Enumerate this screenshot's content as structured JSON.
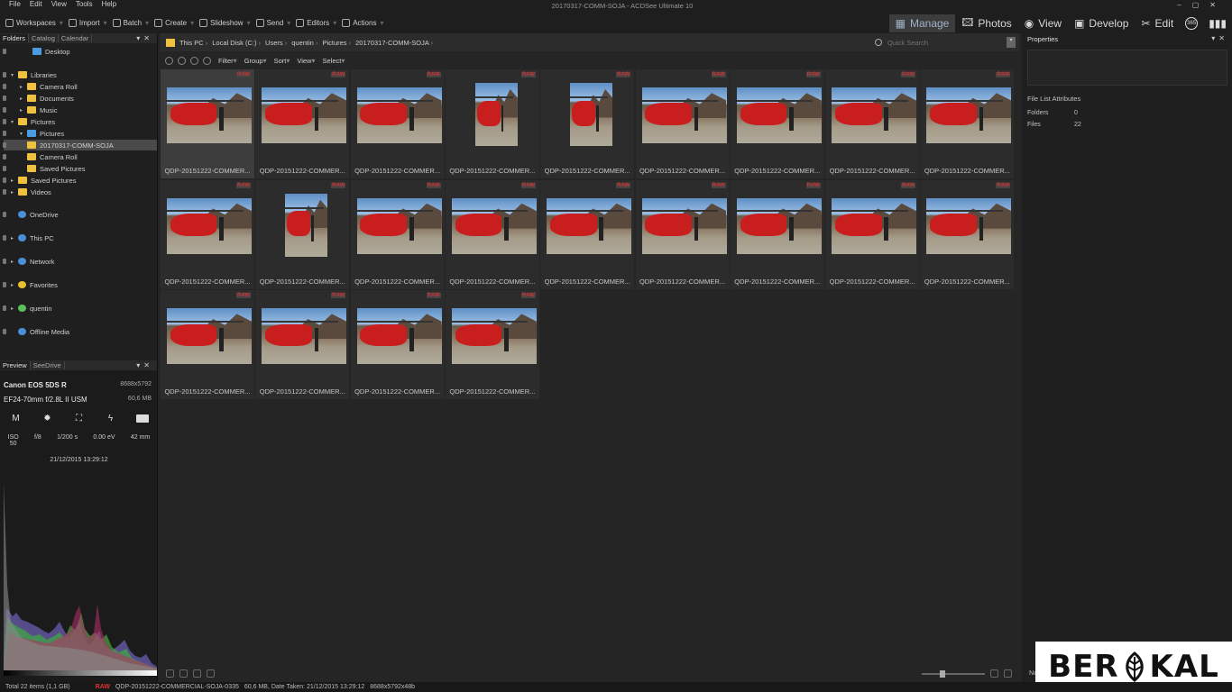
{
  "window": {
    "title": "20170317-COMM-SOJA - ACDSee Ultimate 10"
  },
  "menu": [
    "File",
    "Edit",
    "View",
    "Tools",
    "Help"
  ],
  "toolbar": [
    {
      "label": "Workspaces",
      "icon": "workspaces-icon"
    },
    {
      "label": "Import",
      "icon": "import-icon"
    },
    {
      "label": "Batch",
      "icon": "batch-icon"
    },
    {
      "label": "Create",
      "icon": "create-icon"
    },
    {
      "label": "Slideshow",
      "icon": "slideshow-icon"
    },
    {
      "label": "Send",
      "icon": "send-icon"
    },
    {
      "label": "Editors",
      "icon": "editors-icon"
    },
    {
      "label": "Actions",
      "icon": "actions-icon"
    }
  ],
  "modes": [
    {
      "label": "Manage",
      "icon": "manage-icon",
      "active": true
    },
    {
      "label": "Photos",
      "icon": "photos-icon"
    },
    {
      "label": "View",
      "icon": "eye-icon"
    },
    {
      "label": "Develop",
      "icon": "develop-icon"
    },
    {
      "label": "Edit",
      "icon": "edit-icon"
    }
  ],
  "mode_extras": {
    "badge": "365"
  },
  "left_panel": {
    "tabs": [
      "Folders",
      "Catalog",
      "Calendar"
    ],
    "tree": [
      {
        "label": "Desktop",
        "icon": "folder-blue"
      },
      {
        "label": "Libraries",
        "icon": "folder"
      },
      {
        "label": "Camera Roll",
        "icon": "folder"
      },
      {
        "label": "Documents",
        "icon": "folder"
      },
      {
        "label": "Music",
        "icon": "folder"
      },
      {
        "label": "Pictures",
        "icon": "folder"
      },
      {
        "label": "Pictures",
        "icon": "folder-blue"
      },
      {
        "label": "20170317-COMM-SOJA",
        "icon": "folder",
        "selected": true
      },
      {
        "label": "Camera Roll",
        "icon": "folder"
      },
      {
        "label": "Saved Pictures",
        "icon": "folder"
      },
      {
        "label": "Saved Pictures",
        "icon": "folder"
      },
      {
        "label": "Videos",
        "icon": "folder"
      },
      {
        "label": "OneDrive",
        "icon": "onedrive-icon"
      },
      {
        "label": "This PC",
        "icon": "computer-icon"
      },
      {
        "label": "Network",
        "icon": "network-icon"
      },
      {
        "label": "Favorites",
        "icon": "star-icon"
      },
      {
        "label": "quentin",
        "icon": "user-icon"
      },
      {
        "label": "Offline Media",
        "icon": "offline-media-icon"
      }
    ]
  },
  "preview_panel": {
    "tabs": [
      "Preview",
      "SeeDrive"
    ],
    "camera": "Canon EOS 5DS R",
    "dimensions": "8688x5792",
    "lens": "EF24-70mm f/2.8L II USM",
    "filesize": "60,6 MB",
    "exposure_mode": "M",
    "iso_label": "ISO",
    "iso_value": "50",
    "aperture": "f/8",
    "shutter": "1/200 s",
    "ev": "0.00 eV",
    "focal": "42 mm",
    "date_taken": "21/12/2015 13:29:12"
  },
  "pathbar": {
    "crumbs": [
      "This PC",
      "Local Disk (C:)",
      "Users",
      "quentin",
      "Pictures",
      "20170317-COMM-SOJA"
    ],
    "search_placeholder": "Quick Search"
  },
  "filterbar": [
    "Filter",
    "Group",
    "Sort",
    "View",
    "Select"
  ],
  "thumbnails": {
    "badge": "RAW",
    "name": "QDP-20151222-COMMER...",
    "count": 22,
    "portrait_indices": [
      3,
      4,
      10
    ]
  },
  "properties": {
    "title": "Properties",
    "section": "File List Attributes",
    "folders_label": "Folders",
    "folders_value": "0",
    "files_label": "Files",
    "files_value": "22",
    "no_selection": "No Se..."
  },
  "brand": {
    "left": "BER",
    "right": "KAL"
  },
  "status": {
    "total": "Total 22 items  (1,1 GB)",
    "raw": "RAW",
    "file": "QDP-20151222-COMMERCIAL-SOJA-0335",
    "size": "60,6 MB, Date Taken: 21/12/2015 13:29:12",
    "dims": "8688x5792x48b"
  },
  "colors": {
    "accent": "#9fb3c8",
    "raw_badge": "#cc3333",
    "folder": "#f0c040"
  }
}
